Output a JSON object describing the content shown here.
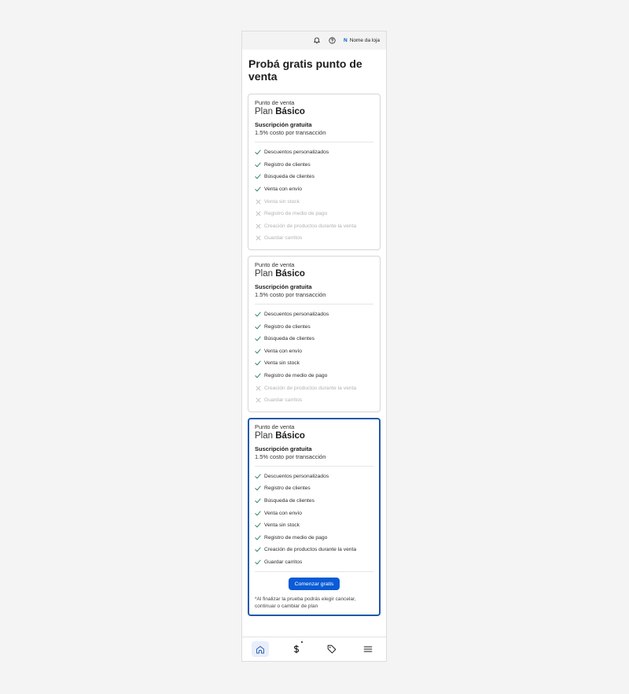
{
  "topbar": {
    "store_initial": "N",
    "store_name": "Nome da loja",
    "icons": [
      "bell-icon",
      "help-icon"
    ]
  },
  "page_title": "Probá gratis punto de venta",
  "cards": [
    {
      "subtitle": "Punto de venta",
      "plan_prefix": "Plan",
      "plan_name": "Básico",
      "subscription": "Suscripción gratuita",
      "cost": "1.5% costo por transacción",
      "features": [
        {
          "label": "Descuentos personalizados",
          "included": true
        },
        {
          "label": "Registro de clientes",
          "included": true
        },
        {
          "label": "Búsqueda de clientes",
          "included": true
        },
        {
          "label": "Venta con envío",
          "included": true
        },
        {
          "label": "Venta sin stock",
          "included": false
        },
        {
          "label": "Registro de medio de pago",
          "included": false
        },
        {
          "label": "Creación de productos durante la venta",
          "included": false
        },
        {
          "label": "Guardar carritos",
          "included": false
        }
      ]
    },
    {
      "subtitle": "Punto de venta",
      "plan_prefix": "Plan",
      "plan_name": "Básico",
      "subscription": "Suscripción gratuita",
      "cost": "1.5% costo por transacción",
      "features": [
        {
          "label": "Descuentos personalizados",
          "included": true
        },
        {
          "label": "Registro de clientes",
          "included": true
        },
        {
          "label": "Búsqueda de clientes",
          "included": true
        },
        {
          "label": "Venta con envío",
          "included": true
        },
        {
          "label": "Venta sin stock",
          "included": true
        },
        {
          "label": "Registro de medio de pago",
          "included": true
        },
        {
          "label": "Creación de productos durante la venta",
          "included": false
        },
        {
          "label": "Guardar carritos",
          "included": false
        }
      ]
    },
    {
      "subtitle": "Punto de venta",
      "plan_prefix": "Plan",
      "plan_name": "Básico",
      "subscription": "Suscripción gratuita",
      "cost": "1.5% costo por transacción",
      "features": [
        {
          "label": "Descuentos personalizados",
          "included": true
        },
        {
          "label": "Registro de clientes",
          "included": true
        },
        {
          "label": "Búsqueda de clientes",
          "included": true
        },
        {
          "label": "Venta con envío",
          "included": true
        },
        {
          "label": "Venta sin stock",
          "included": true
        },
        {
          "label": "Registro de medio de pago",
          "included": true
        },
        {
          "label": "Creación de productos durante la venta",
          "included": true
        },
        {
          "label": "Guardar carritos",
          "included": true
        }
      ],
      "cta_label": "Comenzar gratis",
      "note": "*Al finalizar la prueba podrás elegir cancelar, continuar o cambiar de plan"
    }
  ],
  "bottom_nav": [
    {
      "icon": "home-icon",
      "active": true
    },
    {
      "icon": "dollar-icon",
      "active": false,
      "badge": true
    },
    {
      "icon": "tag-icon",
      "active": false
    },
    {
      "icon": "menu-icon",
      "active": false
    }
  ],
  "colors": {
    "accent": "#0a5bd6",
    "featured_border": "#1f5aa8",
    "check": "#1f7a4d",
    "cross": "#b2b2b2",
    "background": "#f4f4f5"
  }
}
